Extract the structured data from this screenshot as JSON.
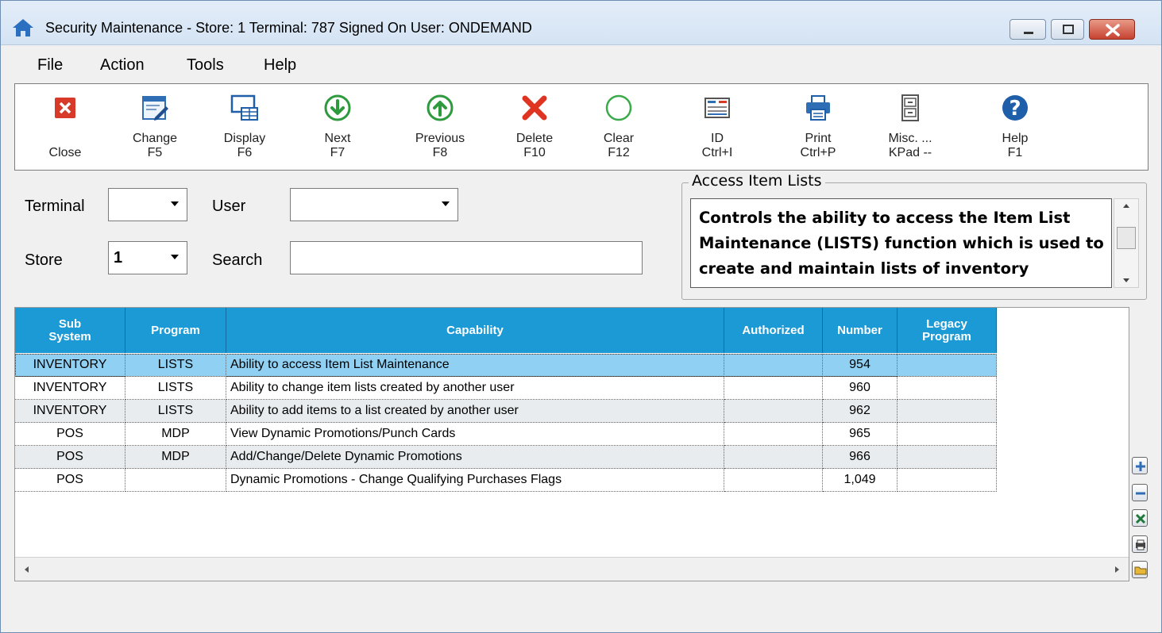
{
  "window": {
    "title": "Security Maintenance  -  Store: 1   Terminal: 787   Signed On User: ONDEMAND"
  },
  "menu": [
    "File",
    "Action",
    "Tools",
    "Help"
  ],
  "toolbar": [
    {
      "l1": "",
      "l2": "Close",
      "icon": "close-icon"
    },
    {
      "l1": "Change",
      "l2": "F5",
      "icon": "edit-form-icon"
    },
    {
      "l1": "Display",
      "l2": "F6",
      "icon": "display-icon"
    },
    {
      "l1": "Next",
      "l2": "F7",
      "icon": "arrow-down-circle-icon"
    },
    {
      "l1": "Previous",
      "l2": "F8",
      "icon": "arrow-up-circle-icon"
    },
    {
      "l1": "Delete",
      "l2": "F10",
      "icon": "delete-x-icon"
    },
    {
      "l1": "Clear",
      "l2": "F12",
      "icon": "clear-circle-icon"
    },
    {
      "l1": "ID",
      "l2": "Ctrl+I",
      "icon": "id-card-icon"
    },
    {
      "l1": "Print",
      "l2": "Ctrl+P",
      "icon": "printer-icon"
    },
    {
      "l1": "Misc. ...",
      "l2": "KPad --",
      "icon": "cabinet-icon"
    },
    {
      "l1": "Help",
      "l2": "F1",
      "icon": "help-icon"
    }
  ],
  "filters": {
    "terminal_label": "Terminal",
    "terminal_value": "",
    "user_label": "User",
    "user_value": "",
    "store_label": "Store",
    "store_value": "1",
    "search_label": "Search",
    "search_value": ""
  },
  "details": {
    "title": "Access Item Lists",
    "text": "Controls the ability to access the Item List Maintenance (LISTS) function which is used to create and maintain lists of inventory"
  },
  "grid": {
    "headers": [
      "Sub\nSystem",
      "Program",
      "Capability",
      "Authorized",
      "Number",
      "Legacy\nProgram"
    ],
    "rows": [
      [
        "INVENTORY",
        "LISTS",
        "Ability to access Item List Maintenance",
        "",
        "954",
        ""
      ],
      [
        "INVENTORY",
        "LISTS",
        "Ability to change item lists created by another user",
        "",
        "960",
        ""
      ],
      [
        "INVENTORY",
        "LISTS",
        "Ability to add items to a list created by another user",
        "",
        "962",
        ""
      ],
      [
        "POS",
        "MDP",
        "View Dynamic Promotions/Punch Cards",
        "",
        "965",
        ""
      ],
      [
        "POS",
        "MDP",
        "Add/Change/Delete Dynamic Promotions",
        "",
        "966",
        ""
      ],
      [
        "POS",
        "",
        "Dynamic Promotions - Change Qualifying Purchases Flags",
        "",
        "1,049",
        ""
      ]
    ],
    "selected_row": 0
  },
  "side_buttons": [
    "plus-icon",
    "minus-icon",
    "excel-icon",
    "print-small-icon",
    "folder-icon"
  ],
  "colors": {
    "header_bg": "#1c9ad6",
    "selected_row": "#8fd0f3",
    "alt_row": "#e8ecef"
  }
}
